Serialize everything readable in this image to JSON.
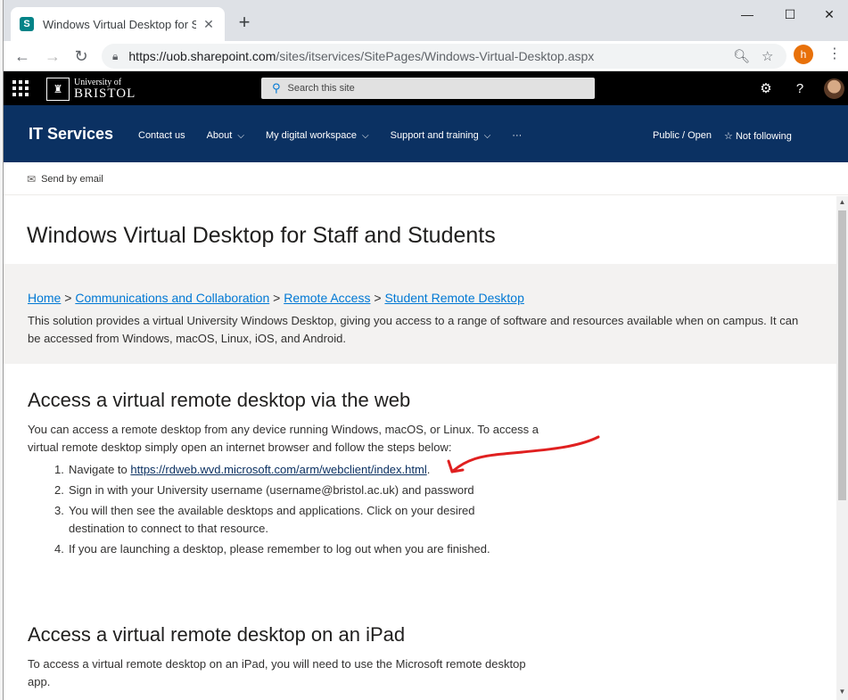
{
  "browser": {
    "tab_title": "Windows Virtual Desktop for Staf",
    "tab_favicon": "S",
    "new_tab": "+",
    "url_host": "https://uob.sharepoint.com",
    "url_path": "/sites/itservices/SitePages/Windows-Virtual-Desktop.aspx",
    "profile_initial": "h",
    "icons": [
      "back-arrow-icon",
      "forward-arrow-icon",
      "reload-icon",
      "lock-icon",
      "zoom-icon",
      "star-icon",
      "kebab-menu-icon",
      "minimize-icon",
      "maximize-icon",
      "close-icon"
    ]
  },
  "suitebar": {
    "logo_small": "University of",
    "logo_big": "BRISTOL",
    "search_placeholder": "Search this site"
  },
  "site": {
    "title": "IT Services",
    "nav": [
      {
        "label": "Contact us"
      },
      {
        "label": "About"
      },
      {
        "label": "My digital workspace"
      },
      {
        "label": "Support and training"
      },
      {
        "label": "···"
      }
    ],
    "privacy": "Public / Open",
    "follow": "Not following",
    "header_color": "#0b3162"
  },
  "command": {
    "send_email": "Send by email"
  },
  "page": {
    "title": "Windows Virtual Desktop for Staff and Students",
    "breadcrumb": [
      "Home",
      "Communications and Collaboration",
      "Remote Access",
      "Student Remote Desktop"
    ],
    "breadcrumb_sep": ">",
    "intro": "This solution provides a virtual University Windows Desktop, giving you access to a range of software and resources available when on campus. It can be accessed from Windows, macOS, Linux, iOS, and Android.",
    "web": {
      "heading": "Access a virtual remote desktop via the web",
      "body": "You can access a remote desktop from any device running Windows, macOS, or Linux.  To access a virtual remote desktop simply open an internet browser and follow the steps below:",
      "step1_prefix": "Navigate to ",
      "step1_link": "https://rdweb.wvd.microsoft.com/arm/webclient/index.html",
      "step1_suffix": ".",
      "step2": "Sign in with your University username (username@bristol.ac.uk) and password",
      "step3": "You will then see the available desktops and applications.  Click on your desired destination to connect to that resource.",
      "step4": "If you are launching a desktop, please remember to log out when you are finished."
    },
    "ipad": {
      "heading": "Access a virtual remote desktop on an iPad",
      "body": "To access a virtual remote desktop on an iPad, you will need to use the Microsoft remote desktop app."
    }
  },
  "annotation_color": "#e02020"
}
